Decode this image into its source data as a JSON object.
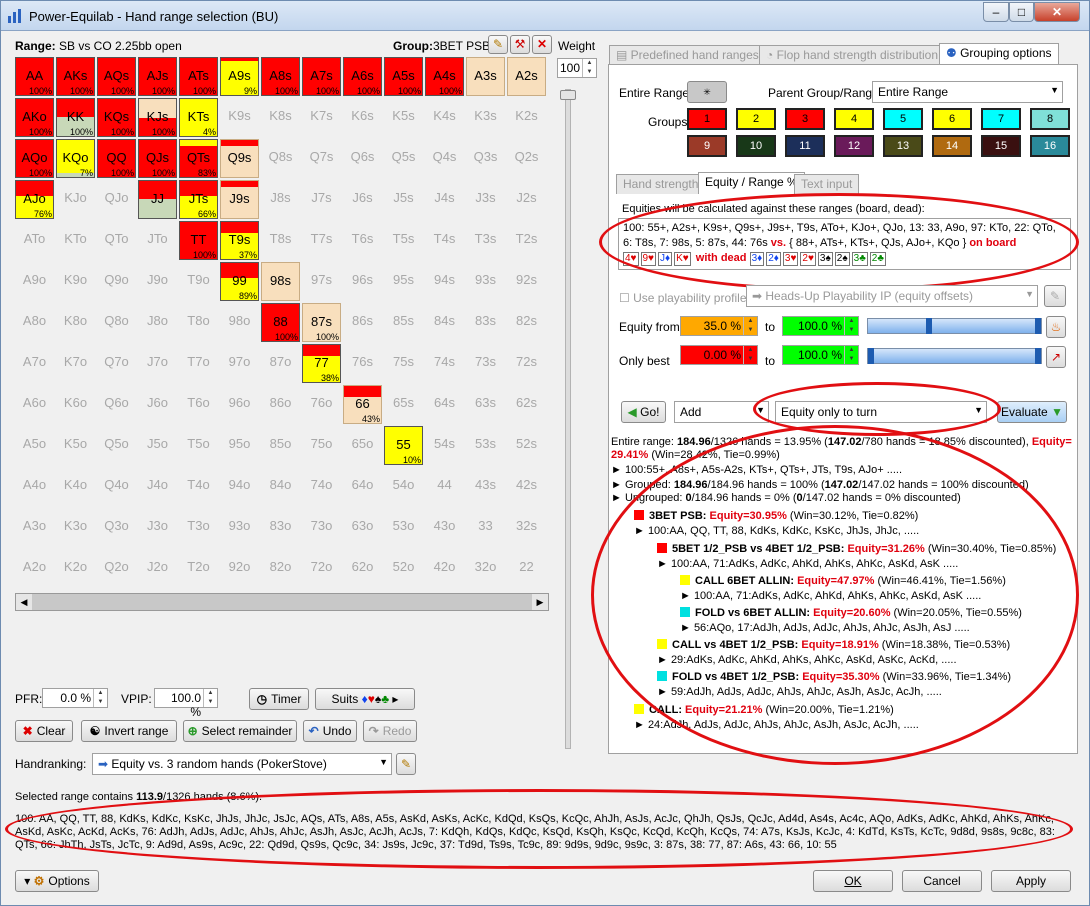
{
  "window": {
    "title": "Power-Equilab - Hand range selection (BU)",
    "min": "–",
    "max": "□",
    "close": "✕"
  },
  "range_label": "Range:",
  "range_name": "SB vs CO 2.25bb open",
  "group_label": "Group:",
  "group_name": "3BET PSB",
  "weight_label": "Weight",
  "weight_value": "100",
  "grid_ranks": [
    "A",
    "K",
    "Q",
    "J",
    "T",
    "9",
    "8",
    "7",
    "6",
    "5",
    "4",
    "3",
    "2"
  ],
  "grid_active": [
    {
      "hand": "AA",
      "color": "#ff0000",
      "pct": "100%"
    },
    {
      "hand": "AKs",
      "color": "#ff0000",
      "pct": "100%"
    },
    {
      "hand": "AQs",
      "color": "#ff0000",
      "pct": "100%"
    },
    {
      "hand": "AJs",
      "color": "#ff0000",
      "pct": "100%"
    },
    {
      "hand": "ATs",
      "color": "#ff0000",
      "pct": "100%"
    },
    {
      "hand": "A9s",
      "color": "#ffff00",
      "pct": "9%",
      "fill": 0.09,
      "fill_color": "#ff0000"
    },
    {
      "hand": "A8s",
      "color": "#ff0000",
      "pct": "100%"
    },
    {
      "hand": "A7s",
      "color": "#ff0000",
      "pct": "100%"
    },
    {
      "hand": "A6s",
      "color": "#ff0000",
      "pct": "100%"
    },
    {
      "hand": "A5s",
      "color": "#ff0000",
      "pct": "100%"
    },
    {
      "hand": "A4s",
      "color": "#ff0000",
      "pct": "100%"
    },
    {
      "hand": "AKo",
      "color": "#ff0000",
      "pct": "100%"
    },
    {
      "hand": "KK",
      "color": "#ff0000",
      "pct": "100%",
      "fill": 0.5,
      "fill_color": "#c8d8b8"
    },
    {
      "hand": "KQs",
      "color": "#ff0000",
      "pct": "100%"
    },
    {
      "hand": "KJs",
      "color": "#ff0000",
      "pct": "100%",
      "fill": 0.5,
      "fill_color": "#f8dfbd"
    },
    {
      "hand": "KTs",
      "color": "#ffff00",
      "pct": "4%"
    },
    {
      "hand": "AQo",
      "color": "#ff0000",
      "pct": "100%"
    },
    {
      "hand": "KQo",
      "color": "#ffff00",
      "pct": "7%",
      "fill": 0.1,
      "fill_color": "#c8d8b8"
    },
    {
      "hand": "QQ",
      "color": "#ff0000",
      "pct": "100%"
    },
    {
      "hand": "QJs",
      "color": "#ff0000",
      "pct": "100%"
    },
    {
      "hand": "QTs",
      "color": "#ff0000",
      "pct": "83%",
      "fill": 0.17,
      "fill_color": "#ffff00"
    },
    {
      "hand": "Q9s",
      "color": "#f8dfbd",
      "pct": "",
      "fill": 0.15,
      "fill_color": "#ff0000"
    },
    {
      "hand": "AJo",
      "color": "#ffff00",
      "pct": "76%",
      "fill": 0.4,
      "fill_color": "#ff0000"
    },
    {
      "hand": "JJ",
      "color": "#ff0000",
      "pct": "",
      "fill": 0.5,
      "fill_color": "#c8d8b8"
    },
    {
      "hand": "JTs",
      "color": "#ffff00",
      "pct": "66%",
      "fill": 0.4,
      "fill_color": "#ff0000"
    },
    {
      "hand": "J9s",
      "color": "#f8dfbd",
      "pct": "",
      "fill": 0.15,
      "fill_color": "#ff0000"
    },
    {
      "hand": "TT",
      "color": "#ff0000",
      "pct": "100%"
    },
    {
      "hand": "T9s",
      "color": "#ffff00",
      "pct": "37%",
      "fill": 0.3,
      "fill_color": "#ff0000"
    },
    {
      "hand": "99",
      "color": "#ffff00",
      "pct": "89%",
      "fill": 0.4,
      "fill_color": "#ff0000"
    },
    {
      "hand": "98s",
      "color": "#f8dfbd",
      "pct": ""
    },
    {
      "hand": "88",
      "color": "#ff0000",
      "pct": "100%"
    },
    {
      "hand": "87s",
      "color": "#f8dfbd",
      "pct": "100%"
    },
    {
      "hand": "77",
      "color": "#ffff00",
      "pct": "38%",
      "fill": 0.3,
      "fill_color": "#ff0000"
    },
    {
      "hand": "66",
      "color": "#f8dfbd",
      "pct": "43%",
      "fill": 0.3,
      "fill_color": "#ff0000"
    },
    {
      "hand": "55",
      "color": "#ffff00",
      "pct": "10%"
    },
    {
      "hand": "A3s",
      "color": "#f8dfbd",
      "pct": ""
    },
    {
      "hand": "A2s",
      "color": "#f8dfbd",
      "pct": ""
    }
  ],
  "pfr_label": "PFR:",
  "pfr_value": "0.0 %",
  "vpip_label": "VPIP:",
  "vpip_value": "100.0 %",
  "timer_btn": "Timer",
  "suits_btn": "Suits",
  "clear_btn": "Clear",
  "invert_btn": "Invert range",
  "select_remainder_btn": "Select remainder",
  "undo_btn": "Undo",
  "redo_btn": "Redo",
  "handranking_label": "Handranking:",
  "handranking_value": "Equity vs. 3 random hands (PokerStove)",
  "selected_text": "Selected range contains",
  "selected_count": "113.9",
  "selected_rest": "/1326 hands (8.6%).",
  "combos_text": "100: AA, QQ, TT, 88, KdKs, KdKc, KsKc, JhJs, JhJc, JsJc, AQs, ATs, A8s, A5s, AsKd, AsKs, AcKc, KdQd, KsQs, KcQc, AhJh, AsJs, AcJc, QhJh, QsJs, QcJc, Ad4d, As4s, Ac4c, AQo, AdKs, AdKc, AhKd, AhKs, AhKc, AsKd, AsKc, AcKd, AcKs, 76: AdJh, AdJs, AdJc, AhJs, AhJc, AsJh, AsJc, AcJh, AcJs, 7: KdQh, KdQs, KdQc, KsQd, KsQh, KsQc, KcQd, KcQh, KcQs, 74: A7s, KsJs, KcJc, 4: KdTd, KsTs, KcTc, 9d8d, 9s8s, 9c8c, 83: QTs, 66: JhTh, JsTs, JcTc, 9: Ad9d, As9s, Ac9c, 22: Qd9d, Qs9s, Qc9c, 34: Js9s, Jc9c, 37: Td9d, Ts9s, Tc9c, 89: 9d9s, 9d9c, 9s9c, 3: 87s, 38: 77, 87: A6s, 43: 66, 10: 55",
  "options_btn": "Options",
  "ok_btn": "OK",
  "cancel_btn": "Cancel",
  "apply_btn": "Apply",
  "tabs_top": [
    "Predefined hand ranges",
    "Flop hand strength distribution",
    "Grouping options"
  ],
  "entire_range_label": "Entire Range:",
  "parent_group_label": "Parent Group/Range:",
  "parent_group_value": "Entire Range",
  "groups_label": "Groups:",
  "groups": [
    {
      "n": "1",
      "c": "#ff0000",
      "t": "#000"
    },
    {
      "n": "2",
      "c": "#ffff00",
      "t": "#000"
    },
    {
      "n": "3",
      "c": "#ff0000",
      "t": "#000"
    },
    {
      "n": "4",
      "c": "#ffff00",
      "t": "#000"
    },
    {
      "n": "5",
      "c": "#00ffff",
      "t": "#000"
    },
    {
      "n": "6",
      "c": "#ffff00",
      "t": "#000"
    },
    {
      "n": "7",
      "c": "#00ffff",
      "t": "#000"
    },
    {
      "n": "8",
      "c": "#80e0d8",
      "t": "#000"
    },
    {
      "n": "9",
      "c": "#9b3a28",
      "t": "#fff"
    },
    {
      "n": "10",
      "c": "#183818",
      "t": "#fff"
    },
    {
      "n": "11",
      "c": "#1c2f5a",
      "t": "#fff"
    },
    {
      "n": "12",
      "c": "#6a1a5a",
      "t": "#fff"
    },
    {
      "n": "13",
      "c": "#4a4a18",
      "t": "#fff"
    },
    {
      "n": "14",
      "c": "#b06a10",
      "t": "#fff"
    },
    {
      "n": "15",
      "c": "#3a1010",
      "t": "#fff"
    },
    {
      "n": "16",
      "c": "#2a8a9a",
      "t": "#fff"
    }
  ],
  "subtabs": [
    "Hand strength",
    "Equity / Range %",
    "Text input"
  ],
  "equity_note": "Equities will be calculated against these ranges (board, dead):",
  "ranges_text": "100: 55+, A2s+, K9s+, Q9s+, J9s+, T9s, ATo+, KJo+, QJo, 13: 33, A9o, 97: KTo, 22: QTo, 6: T8s, 7: 98s, 5: 87s, 44: 76s",
  "ranges_vs": "vs.",
  "ranges_vs_text": "{ 88+, ATs+, KTs+, QJs, AJo+, KQo }",
  "on_board": "on board",
  "board_cards": [
    {
      "r": "4",
      "s": "♥",
      "c": "#d00"
    },
    {
      "r": "9",
      "s": "♥",
      "c": "#d00"
    },
    {
      "r": "J",
      "s": "♦",
      "c": "#14e"
    },
    {
      "r": "K",
      "s": "♥",
      "c": "#d00"
    }
  ],
  "with_dead": "with dead",
  "dead_cards": [
    {
      "r": "3",
      "s": "♦",
      "c": "#14e"
    },
    {
      "r": "2",
      "s": "♦",
      "c": "#14e"
    },
    {
      "r": "3",
      "s": "♥",
      "c": "#d00"
    },
    {
      "r": "2",
      "s": "♥",
      "c": "#d00"
    },
    {
      "r": "3",
      "s": "♠",
      "c": "#000"
    },
    {
      "r": "2",
      "s": "♠",
      "c": "#000"
    },
    {
      "r": "3",
      "s": "♣",
      "c": "#080"
    },
    {
      "r": "2",
      "s": "♣",
      "c": "#080"
    }
  ],
  "use_playability": "Use playability profile",
  "playability_value": "Heads-Up Playability IP (equity offsets)",
  "equity_from_label": "Equity from",
  "equity_from_value": "35.0 %",
  "to1": "to",
  "to1_value": "100.0 %",
  "only_best_label": "Only best",
  "only_best_value": "0.00 %",
  "to2": "to",
  "to2_value": "100.0 %",
  "go_btn": "Go!",
  "add_value": "Add",
  "mode_value": "Equity only to turn",
  "evaluate_btn": "Evaluate",
  "results": [
    {
      "indent": 0,
      "sw": "",
      "segs": [
        {
          "t": "Entire range: "
        },
        {
          "t": "184.96",
          "b": 1
        },
        {
          "t": "/1326 hands = 13.95% ("
        },
        {
          "t": "147.02",
          "b": 1
        },
        {
          "t": "/780 hands = 18.85% discounted), "
        },
        {
          "t": "Equity=",
          "r": 1
        }
      ]
    },
    {
      "indent": 0,
      "sw": "",
      "segs": [
        {
          "t": "29.41%",
          "r": 1
        },
        {
          "t": " (Win=28.42%, Tie=0.99%)"
        }
      ]
    },
    {
      "indent": 0,
      "sw": "",
      "segs": [
        {
          "t": "► 100:55+, A8s+, A5s-A2s, KTs+, QTs+, JTs, T9s, AJo+ ....."
        }
      ]
    },
    {
      "indent": 0,
      "sw": "",
      "segs": [
        {
          "t": "► Grouped: "
        },
        {
          "t": "184.96",
          "b": 1
        },
        {
          "t": "/184.96 hands = 100% ("
        },
        {
          "t": "147.02",
          "b": 1
        },
        {
          "t": "/147.02 hands = 100% discounted)"
        }
      ]
    },
    {
      "indent": 0,
      "sw": "",
      "segs": [
        {
          "t": "► Ungrouped: "
        },
        {
          "t": "0",
          "b": 1
        },
        {
          "t": "/184.96 hands = 0% ("
        },
        {
          "t": "0",
          "b": 1
        },
        {
          "t": "/147.02 hands = 0% discounted)"
        }
      ]
    },
    {
      "indent": 1,
      "sw": "#ff0000",
      "segs": [
        {
          "t": "3BET PSB: ",
          "b": 1
        },
        {
          "t": "Equity=30.95%",
          "r": 1
        },
        {
          "t": " (Win=30.12%, Tie=0.82%)"
        }
      ]
    },
    {
      "indent": 1,
      "sw": "",
      "segs": [
        {
          "t": "► 100:AA, QQ, TT, 88, KdKs, KdKc, KsKc, JhJs, JhJc, ....."
        }
      ]
    },
    {
      "indent": 2,
      "sw": "#ff0000",
      "segs": [
        {
          "t": "5BET 1/2_PSB vs 4BET 1/2_PSB: ",
          "b": 1
        },
        {
          "t": "Equity=31.26%",
          "r": 1
        },
        {
          "t": " (Win=30.40%, Tie=0.85%)"
        }
      ]
    },
    {
      "indent": 2,
      "sw": "",
      "segs": [
        {
          "t": "► 100:AA, 71:AdKs, AdKc, AhKd, AhKs, AhKc, AsKd, AsK ....."
        }
      ]
    },
    {
      "indent": 3,
      "sw": "#ffff00",
      "segs": [
        {
          "t": "CALL 6BET ALLIN: ",
          "b": 1
        },
        {
          "t": "Equity=47.97%",
          "r": 1
        },
        {
          "t": " (Win=46.41%, Tie=1.56%)"
        }
      ]
    },
    {
      "indent": 3,
      "sw": "",
      "segs": [
        {
          "t": "► 100:AA, 71:AdKs, AdKc, AhKd, AhKs, AhKc, AsKd, AsK ....."
        }
      ]
    },
    {
      "indent": 3,
      "sw": "#00e0e0",
      "segs": [
        {
          "t": "FOLD vs 6BET ALLIN: ",
          "b": 1
        },
        {
          "t": "Equity=20.60%",
          "r": 1
        },
        {
          "t": " (Win=20.05%, Tie=0.55%)"
        }
      ]
    },
    {
      "indent": 3,
      "sw": "",
      "segs": [
        {
          "t": "► 56:AQo, 17:AdJh, AdJs, AdJc, AhJs, AhJc, AsJh, AsJ ....."
        }
      ]
    },
    {
      "indent": 2,
      "sw": "#ffff00",
      "segs": [
        {
          "t": "CALL vs 4BET 1/2_PSB: ",
          "b": 1
        },
        {
          "t": "Equity=18.91%",
          "r": 1
        },
        {
          "t": " (Win=18.38%, Tie=0.53%)"
        }
      ]
    },
    {
      "indent": 2,
      "sw": "",
      "segs": [
        {
          "t": "► 29:AdKs, AdKc, AhKd, AhKs, AhKc, AsKd, AsKc, AcKd, ....."
        }
      ]
    },
    {
      "indent": 2,
      "sw": "#00e0e0",
      "segs": [
        {
          "t": "FOLD vs 4BET 1/2_PSB: ",
          "b": 1
        },
        {
          "t": "Equity=35.30%",
          "r": 1
        },
        {
          "t": " (Win=33.96%, Tie=1.34%)"
        }
      ]
    },
    {
      "indent": 2,
      "sw": "",
      "segs": [
        {
          "t": "► 59:AdJh, AdJs, AdJc, AhJs, AhJc, AsJh, AsJc, AcJh, ....."
        }
      ]
    },
    {
      "indent": 1,
      "sw": "#ffff00",
      "segs": [
        {
          "t": "CALL: ",
          "b": 1
        },
        {
          "t": "Equity=21.21%",
          "r": 1
        },
        {
          "t": " (Win=20.00%, Tie=1.21%)"
        }
      ]
    },
    {
      "indent": 1,
      "sw": "",
      "segs": [
        {
          "t": "► 24:AdJh, AdJs, AdJc, AhJs, AhJc, AsJh, AsJc, AcJh, ....."
        }
      ]
    }
  ]
}
